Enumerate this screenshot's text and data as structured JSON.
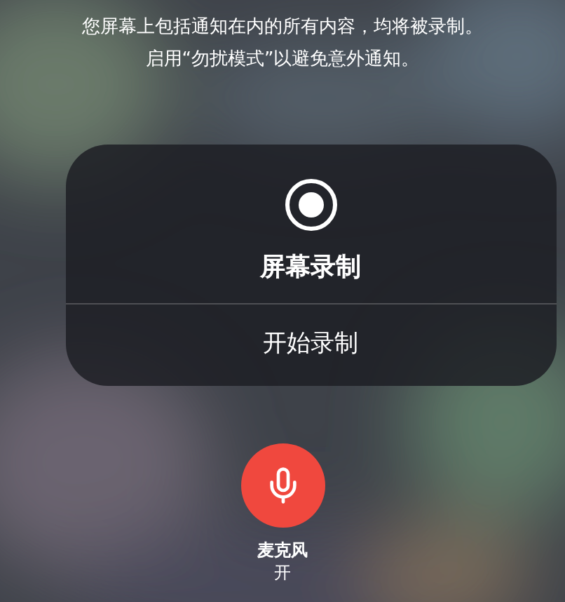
{
  "notice": [
    "您屏幕上包括通知在内的所有内容，均将被录制。",
    "启用“勿扰模式”以避免意外通知。"
  ],
  "panel": {
    "title": "屏幕录制",
    "action": "开始录制"
  },
  "microphone": {
    "label": "麦克风",
    "status": "开",
    "on": true
  }
}
